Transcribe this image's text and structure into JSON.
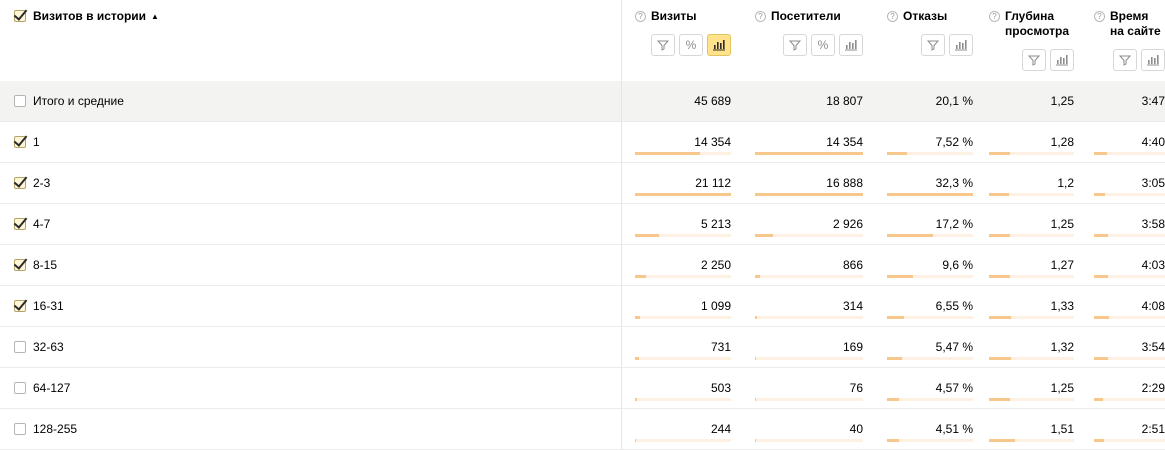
{
  "header": {
    "dimension": {
      "label": "Визитов в истории",
      "sort": "▲"
    },
    "metrics": [
      {
        "label": "Визиты",
        "tools": [
          "filter-icon",
          "percent-icon",
          "chart-icon"
        ],
        "active_tool": 2
      },
      {
        "label": "Посетители",
        "tools": [
          "filter-icon",
          "percent-icon",
          "chart-icon"
        ],
        "active_tool": -1
      },
      {
        "label": "Отказы",
        "tools": [
          "filter-icon",
          "chart-icon"
        ],
        "active_tool": -1
      },
      {
        "label": "Глубина просмотра",
        "tools": [
          "filter-icon",
          "chart-icon"
        ],
        "active_tool": -1
      },
      {
        "label": "Время на сайте",
        "tools": [
          "filter-icon",
          "chart-icon"
        ],
        "active_tool": -1
      }
    ]
  },
  "total": {
    "label": "Итого и средние",
    "checked": false,
    "values": [
      "45 689",
      "18 807",
      "20,1 %",
      "1,25",
      "3:47"
    ]
  },
  "rows": [
    {
      "label": "1",
      "checked": true,
      "values": [
        "14 354",
        "14 354",
        "7,52 %",
        "1,28",
        "4:40"
      ],
      "bars": [
        0.68,
        1.0,
        0.23,
        0.25,
        0.18
      ]
    },
    {
      "label": "2-3",
      "checked": true,
      "values": [
        "21 112",
        "16 888",
        "32,3 %",
        "1,2",
        "3:05"
      ],
      "bars": [
        1.0,
        1.0,
        1.0,
        0.24,
        0.16
      ]
    },
    {
      "label": "4-7",
      "checked": true,
      "values": [
        "5 213",
        "2 926",
        "17,2 %",
        "1,25",
        "3:58"
      ],
      "bars": [
        0.25,
        0.17,
        0.53,
        0.25,
        0.2
      ]
    },
    {
      "label": "8-15",
      "checked": true,
      "values": [
        "2 250",
        "866",
        "9,6 %",
        "1,27",
        "4:03"
      ],
      "bars": [
        0.11,
        0.05,
        0.3,
        0.25,
        0.2
      ]
    },
    {
      "label": "16-31",
      "checked": true,
      "values": [
        "1 099",
        "314",
        "6,55 %",
        "1,33",
        "4:08"
      ],
      "bars": [
        0.05,
        0.02,
        0.2,
        0.26,
        0.21
      ]
    },
    {
      "label": "32-63",
      "checked": false,
      "values": [
        "731",
        "169",
        "5,47 %",
        "1,32",
        "3:54"
      ],
      "bars": [
        0.04,
        0.01,
        0.17,
        0.26,
        0.2
      ]
    },
    {
      "label": "64-127",
      "checked": false,
      "values": [
        "503",
        "76",
        "4,57 %",
        "1,25",
        "2:29"
      ],
      "bars": [
        0.02,
        0.005,
        0.14,
        0.25,
        0.12
      ]
    },
    {
      "label": "128-255",
      "checked": false,
      "values": [
        "244",
        "40",
        "4,51 %",
        "1,51",
        "2:51"
      ],
      "bars": [
        0.01,
        0.003,
        0.14,
        0.3,
        0.14
      ]
    }
  ],
  "colors": {
    "bar_track": "#fdf1e3",
    "bar_fill": "#f8c78c",
    "active_tool": "#ffe28a",
    "total_row_bg": "#f3f3f2"
  }
}
